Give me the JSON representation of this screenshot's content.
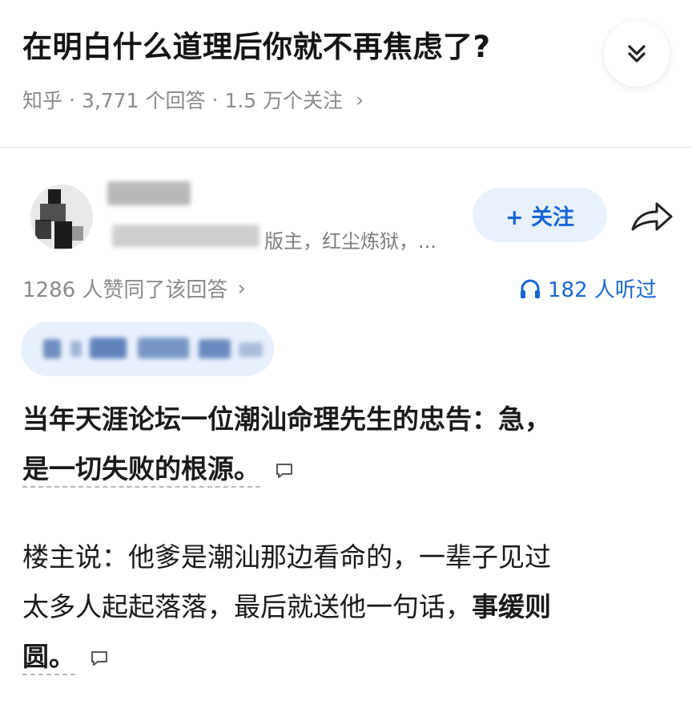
{
  "question": {
    "title": "在明白什么道理后你就不再焦虑了?",
    "source": "知乎",
    "answer_count": "3,771 个回答",
    "follow_count": "1.5 万个关注",
    "separator": "·",
    "chevron": "›"
  },
  "author": {
    "subtitle": "版主，红尘炼狱，...",
    "follow_label": "+ 关注"
  },
  "stats": {
    "likes": "1286 人赞同了该回答",
    "listened": "182 人听过"
  },
  "content": {
    "p1_line1": "当年天涯论坛一位潮汕命理先生的忠告：急，",
    "p1_line2": "是一切失败的根源。",
    "p2_line1": "楼主说：他爹是潮汕那边看命的，一辈子见过",
    "p2_line2_normal": "太多人起起落落，最后就送他一句话，",
    "p2_line2_bold": "事缓则",
    "p2_line3": "圆。"
  },
  "icons": {
    "collapse": "double-chevron-down-icon",
    "share": "share-arrow-icon",
    "headphones": "headphones-icon",
    "comment": "comment-icon"
  },
  "colors": {
    "accent": "#1766d6",
    "follow_bg": "#e9f1fd",
    "muted_text": "#8a8a8a"
  }
}
